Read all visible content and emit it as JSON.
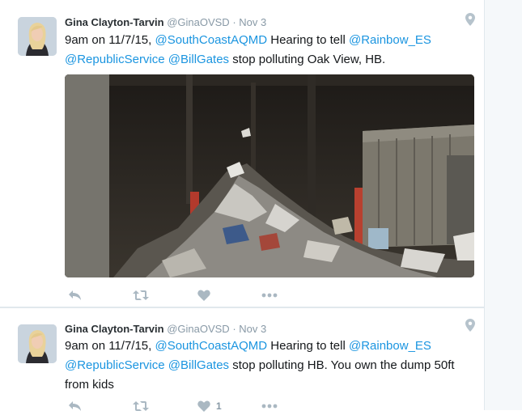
{
  "tweets": [
    {
      "author_name": "Gina Clayton-Tarvin",
      "handle": "@GinaOVSD",
      "separator": "·",
      "time": "Nov 3",
      "text_parts": [
        {
          "text": "9am on 11/7/15, ",
          "mention": false
        },
        {
          "text": "@SouthCoastAQMD",
          "mention": true
        },
        {
          "text": " Hearing to tell ",
          "mention": false
        },
        {
          "text": "@Rainbow_ES",
          "mention": true
        },
        {
          "text": " ",
          "mention": false
        },
        {
          "text": "@RepublicService",
          "mention": true
        },
        {
          "text": " ",
          "mention": false
        },
        {
          "text": "@BillGates",
          "mention": true
        },
        {
          "text": " stop polluting Oak View, HB.",
          "mention": false
        }
      ],
      "has_media": true,
      "like_count": ""
    },
    {
      "author_name": "Gina Clayton-Tarvin",
      "handle": "@GinaOVSD",
      "separator": "·",
      "time": "Nov 3",
      "text_parts": [
        {
          "text": "9am on 11/7/15, ",
          "mention": false
        },
        {
          "text": "@SouthCoastAQMD",
          "mention": true
        },
        {
          "text": " Hearing to tell ",
          "mention": false
        },
        {
          "text": "@Rainbow_ES",
          "mention": true
        },
        {
          "text": " ",
          "mention": false
        },
        {
          "text": "@RepublicService",
          "mention": true
        },
        {
          "text": " ",
          "mention": false
        },
        {
          "text": "@BillGates",
          "mention": true
        },
        {
          "text": " stop polluting HB. You own the dump 50ft from kids",
          "mention": false
        }
      ],
      "has_media": false,
      "like_count": "1"
    }
  ],
  "icons": {
    "location": "map-pin-icon",
    "reply": "reply-icon",
    "retweet": "retweet-icon",
    "like": "heart-icon",
    "more": "more-dots-icon"
  },
  "colors": {
    "link": "#1b95e0",
    "meta": "#8899a6",
    "action": "#aab8c2",
    "border": "#e1e8ed"
  }
}
